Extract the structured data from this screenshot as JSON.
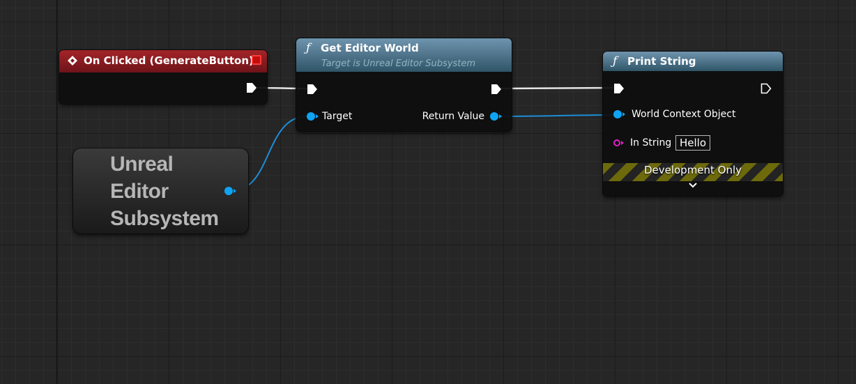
{
  "nodes": {
    "on_clicked": {
      "title": "On Clicked (GenerateButton)"
    },
    "get_editor_world": {
      "title": "Get Editor World",
      "subtitle": "Target is Unreal Editor Subsystem",
      "input_target_label": "Target",
      "output_return_label": "Return Value"
    },
    "print_string": {
      "title": "Print String",
      "world_context_label": "World Context Object",
      "in_string_label": "In String",
      "in_string_value": "Hello",
      "banner": "Development Only"
    },
    "subsystem": {
      "label": "Unreal Editor Subsystem"
    }
  },
  "colors": {
    "event_header": "#a32428",
    "function_header": "#4f7690",
    "object_pin": "#0fa4f3",
    "string_pin": "#e021c7",
    "exec_wire": "#e6e6e6",
    "dev_stripe": "#6d6a0c"
  },
  "icons": {
    "event": "event-diamond-icon",
    "delegate": "delegate-icon",
    "function": "function-icon",
    "chevron": "chevron-down-icon"
  }
}
